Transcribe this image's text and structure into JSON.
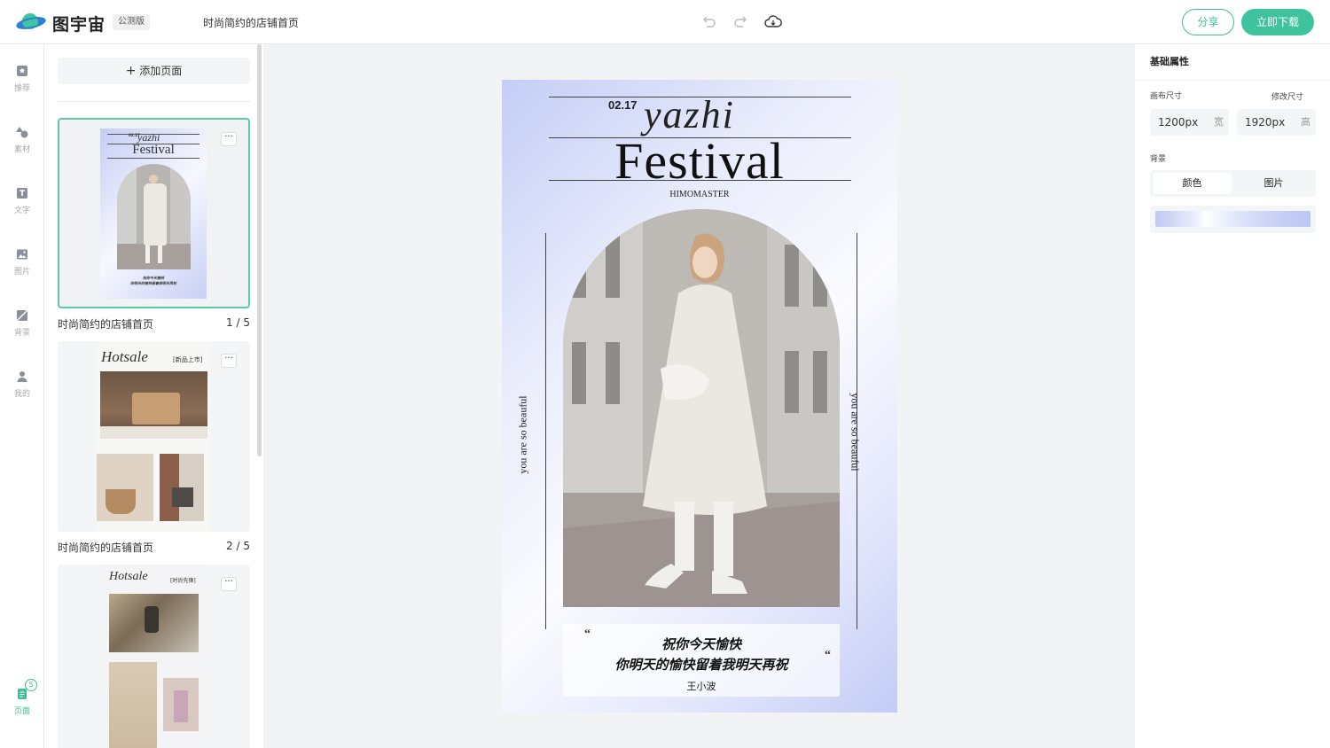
{
  "app": {
    "brand": "图宇宙",
    "beta_badge": "公测版",
    "doc_title": "时尚简约的店铺首页"
  },
  "toolbar": {
    "share_label": "分享",
    "download_label": "立即下载"
  },
  "nav": {
    "items": [
      {
        "label": "推荐",
        "icon": "recommend-icon"
      },
      {
        "label": "素材",
        "icon": "shapes-icon"
      },
      {
        "label": "文字",
        "icon": "text-icon"
      },
      {
        "label": "图片",
        "icon": "image-icon"
      },
      {
        "label": "背景",
        "icon": "background-icon"
      },
      {
        "label": "我的",
        "icon": "user-icon"
      }
    ],
    "pages": {
      "label": "页面",
      "badge": "5",
      "icon": "pages-icon"
    }
  },
  "pages_panel": {
    "add_label": "添加页面",
    "add_icon": "plus-icon",
    "more_icon": "more-dots-icon",
    "more_text": "···",
    "cards": [
      {
        "label": "时尚简约的店铺首页",
        "num": "1 / 5"
      },
      {
        "label": "时尚简约的店铺首页",
        "num": "2 / 5"
      },
      {
        "label": "",
        "num": ""
      }
    ],
    "thumb1": {
      "date": "02.17",
      "script": "yazhi",
      "title": "Festival",
      "line1": "祝你今天愉快",
      "line2": "你明天的愉快留着我明天再祝"
    },
    "thumb2": {
      "script": "Hotsale",
      "tag": "[新品上市]"
    },
    "thumb3": {
      "script": "Hotsale",
      "tag": "[时尚先锋]"
    }
  },
  "poster": {
    "date": "02.17",
    "script": "yazhi",
    "title": "Festival",
    "subtitle": "HIMOMASTER",
    "side_left": "you are so beauful",
    "side_right": "you are so beauful",
    "open_quote": "“",
    "close_quote": "“",
    "line1": "祝你今天愉快",
    "line2": "你明天的愉快留着我明天再祝",
    "author": "王小波"
  },
  "props": {
    "title": "基础属性",
    "canvas_size_label": "画布尺寸",
    "resize_label": "修改尺寸",
    "width_value": "1200px",
    "width_unit": "宽",
    "height_value": "1920px",
    "height_unit": "高",
    "bg_label": "背景",
    "bg_tabs": [
      "颜色",
      "图片"
    ],
    "bg_gradient_colors": [
      "#bfc9f3",
      "#ffffff",
      "#c6cff5"
    ]
  },
  "colors": {
    "accent": "#3fc39c",
    "poster_bg": "#c4cdf6"
  }
}
